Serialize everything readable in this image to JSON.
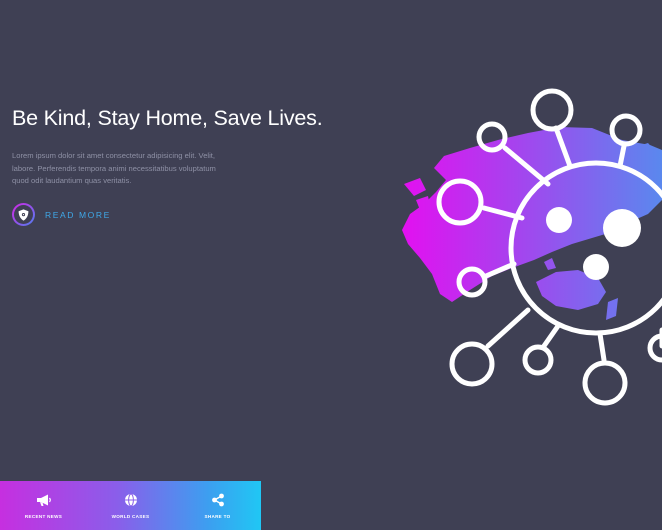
{
  "hero": {
    "title": "Be Kind, Stay Home, Save Lives.",
    "text": "Lorem ipsum dolor sit amet consectetur adipisicing elit. Velit, labore. Perferendis tempora animi necessitatibus voluptatum quod odit laudantium quas veritatis.",
    "cta_label": "Read More",
    "cta_icon": "shield-virus-icon"
  },
  "bottom_nav": {
    "items": [
      {
        "label": "RECENT NEWS",
        "icon": "megaphone-icon"
      },
      {
        "label": "WORLD CASES",
        "icon": "globe-icon"
      },
      {
        "label": "SHARE TO",
        "icon": "share-icon"
      }
    ]
  },
  "colors": {
    "background": "#3f4054",
    "accent_magenta": "#e014ec",
    "accent_violet": "#9b56ec",
    "accent_blue": "#4a9af0",
    "accent_cyan": "#20c7f4",
    "link": "#3fa8e8"
  }
}
